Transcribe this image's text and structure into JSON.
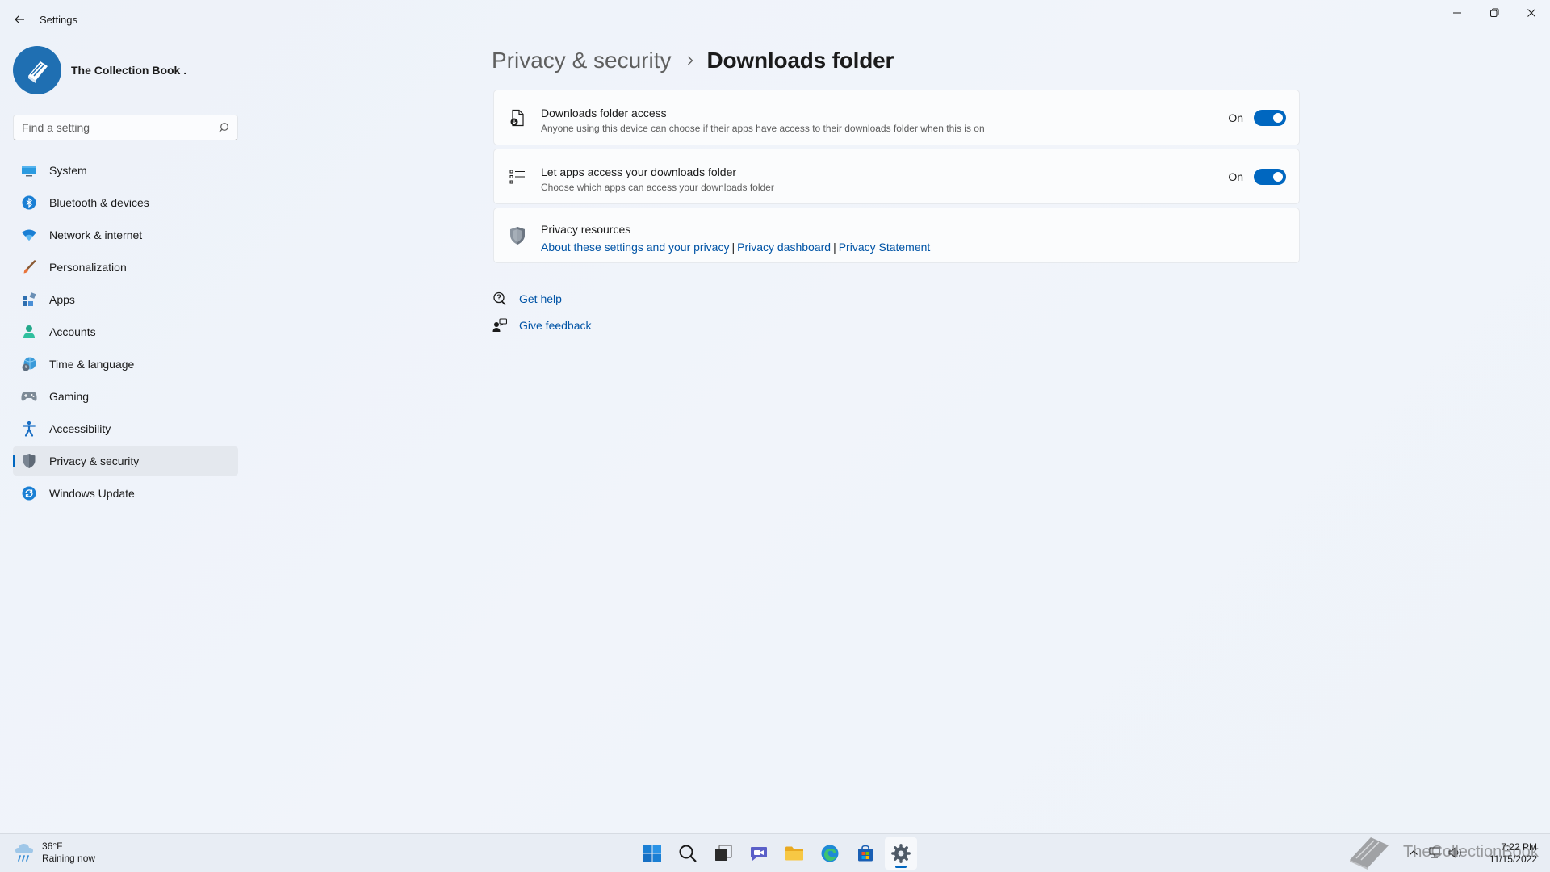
{
  "window": {
    "app_title": "Settings"
  },
  "profile": {
    "name": "The Collection Book ."
  },
  "search": {
    "placeholder": "Find a setting"
  },
  "sidebar": {
    "items": [
      {
        "label": "System",
        "icon": "monitor-icon"
      },
      {
        "label": "Bluetooth & devices",
        "icon": "bluetooth-icon"
      },
      {
        "label": "Network & internet",
        "icon": "wifi-icon"
      },
      {
        "label": "Personalization",
        "icon": "brush-icon"
      },
      {
        "label": "Apps",
        "icon": "apps-icon"
      },
      {
        "label": "Accounts",
        "icon": "person-icon"
      },
      {
        "label": "Time & language",
        "icon": "globe-clock-icon"
      },
      {
        "label": "Gaming",
        "icon": "gamepad-icon"
      },
      {
        "label": "Accessibility",
        "icon": "accessibility-icon"
      },
      {
        "label": "Privacy & security",
        "icon": "shield-icon",
        "active": true
      },
      {
        "label": "Windows Update",
        "icon": "update-icon"
      }
    ]
  },
  "breadcrumb": {
    "parent": "Privacy & security",
    "current": "Downloads folder"
  },
  "settings": {
    "downloads_access": {
      "title": "Downloads folder access",
      "description": "Anyone using this device can choose if their apps have access to their downloads folder when this is on",
      "state": "On"
    },
    "apps_access": {
      "title": "Let apps access your downloads folder",
      "description": "Choose which apps can access your downloads folder",
      "state": "On"
    },
    "privacy_resources": {
      "title": "Privacy resources",
      "links": [
        "About these settings and your privacy",
        "Privacy dashboard",
        "Privacy Statement"
      ]
    }
  },
  "help": {
    "get_help": "Get help",
    "give_feedback": "Give feedback"
  },
  "taskbar": {
    "weather_temp": "36°F",
    "weather_desc": "Raining now",
    "time": "7:22 PM",
    "date": "11/15/2022"
  },
  "watermark": {
    "text": "TheCollectionBook"
  },
  "colors": {
    "accent": "#0067c0",
    "link": "#0054a6",
    "background": "#eef3f9"
  }
}
